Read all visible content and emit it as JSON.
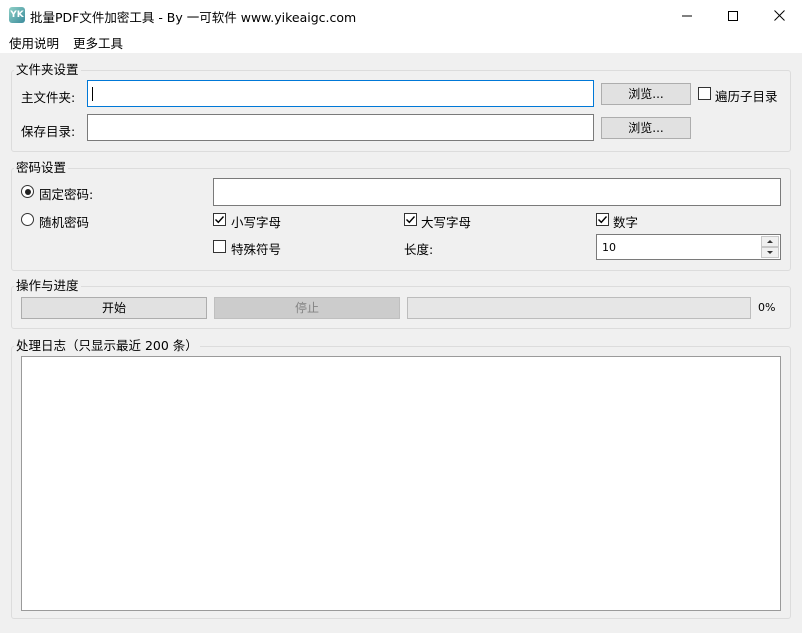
{
  "window": {
    "title": "批量PDF文件加密工具 - By 一可软件 www.yikeaigc.com",
    "icon": "app-icon",
    "icon_text": "YK"
  },
  "menu": {
    "items": [
      "使用说明",
      "更多工具"
    ]
  },
  "folder_settings": {
    "legend": "文件夹设置",
    "main_folder_label": "主文件夹:",
    "main_folder_value": "",
    "save_dir_label": "保存目录:",
    "save_dir_value": "",
    "browse_label": "浏览...",
    "traverse_subdirs_label": "遍历子目录",
    "traverse_subdirs_checked": false
  },
  "password_settings": {
    "legend": "密码设置",
    "fixed_label": "固定密码:",
    "fixed_value": "",
    "random_label": "随机密码",
    "selected_mode": "fixed",
    "lowercase_label": "小写字母",
    "lowercase_checked": true,
    "uppercase_label": "大写字母",
    "uppercase_checked": true,
    "digits_label": "数字",
    "digits_checked": true,
    "special_label": "特殊符号",
    "special_checked": false,
    "length_label": "长度:",
    "length_value": "10"
  },
  "operation": {
    "legend": "操作与进度",
    "start_label": "开始",
    "stop_label": "停止",
    "progress_percent": 0,
    "progress_text": "0%"
  },
  "log": {
    "legend": "处理日志（只显示最近 200 条）",
    "content": ""
  },
  "colors": {
    "focus_border": "#0078d7",
    "client_background": "#f0f0f0",
    "progress_fill": "#06b025"
  }
}
